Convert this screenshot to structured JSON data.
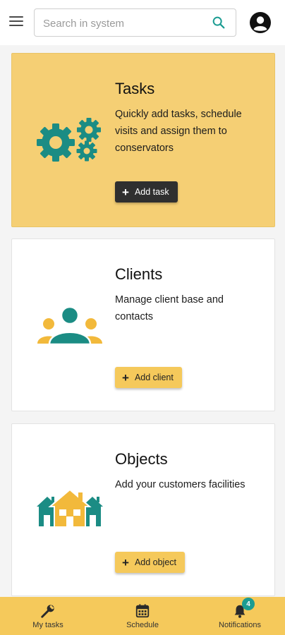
{
  "header": {
    "search_placeholder": "Search in system",
    "menu_icon": "hamburger-menu-icon",
    "search_icon": "search-icon",
    "account_icon": "account-circle-icon"
  },
  "cards": [
    {
      "title": "Tasks",
      "description": "Quickly add tasks, schedule visits and assign them to conservators",
      "button_label": "Add task",
      "illustration": "gears-illustration",
      "highlighted": true
    },
    {
      "title": "Clients",
      "description": "Manage client base and contacts",
      "button_label": "Add client",
      "illustration": "people-group-illustration",
      "highlighted": false
    },
    {
      "title": "Objects",
      "description": "Add your customers facilities",
      "button_label": "Add object",
      "illustration": "houses-illustration",
      "highlighted": false
    }
  ],
  "bottom_nav": {
    "items": [
      {
        "label": "My tasks",
        "icon": "wrench-icon"
      },
      {
        "label": "Schedule",
        "icon": "calendar-icon"
      },
      {
        "label": "Notifications",
        "icon": "bell-icon",
        "badge": "4"
      }
    ]
  },
  "colors": {
    "accent_yellow": "#f5c95b",
    "highlight_card": "#f5cf74",
    "teal": "#1b8c84",
    "gold": "#f2b93b",
    "dark_button": "#2f2f2f"
  }
}
